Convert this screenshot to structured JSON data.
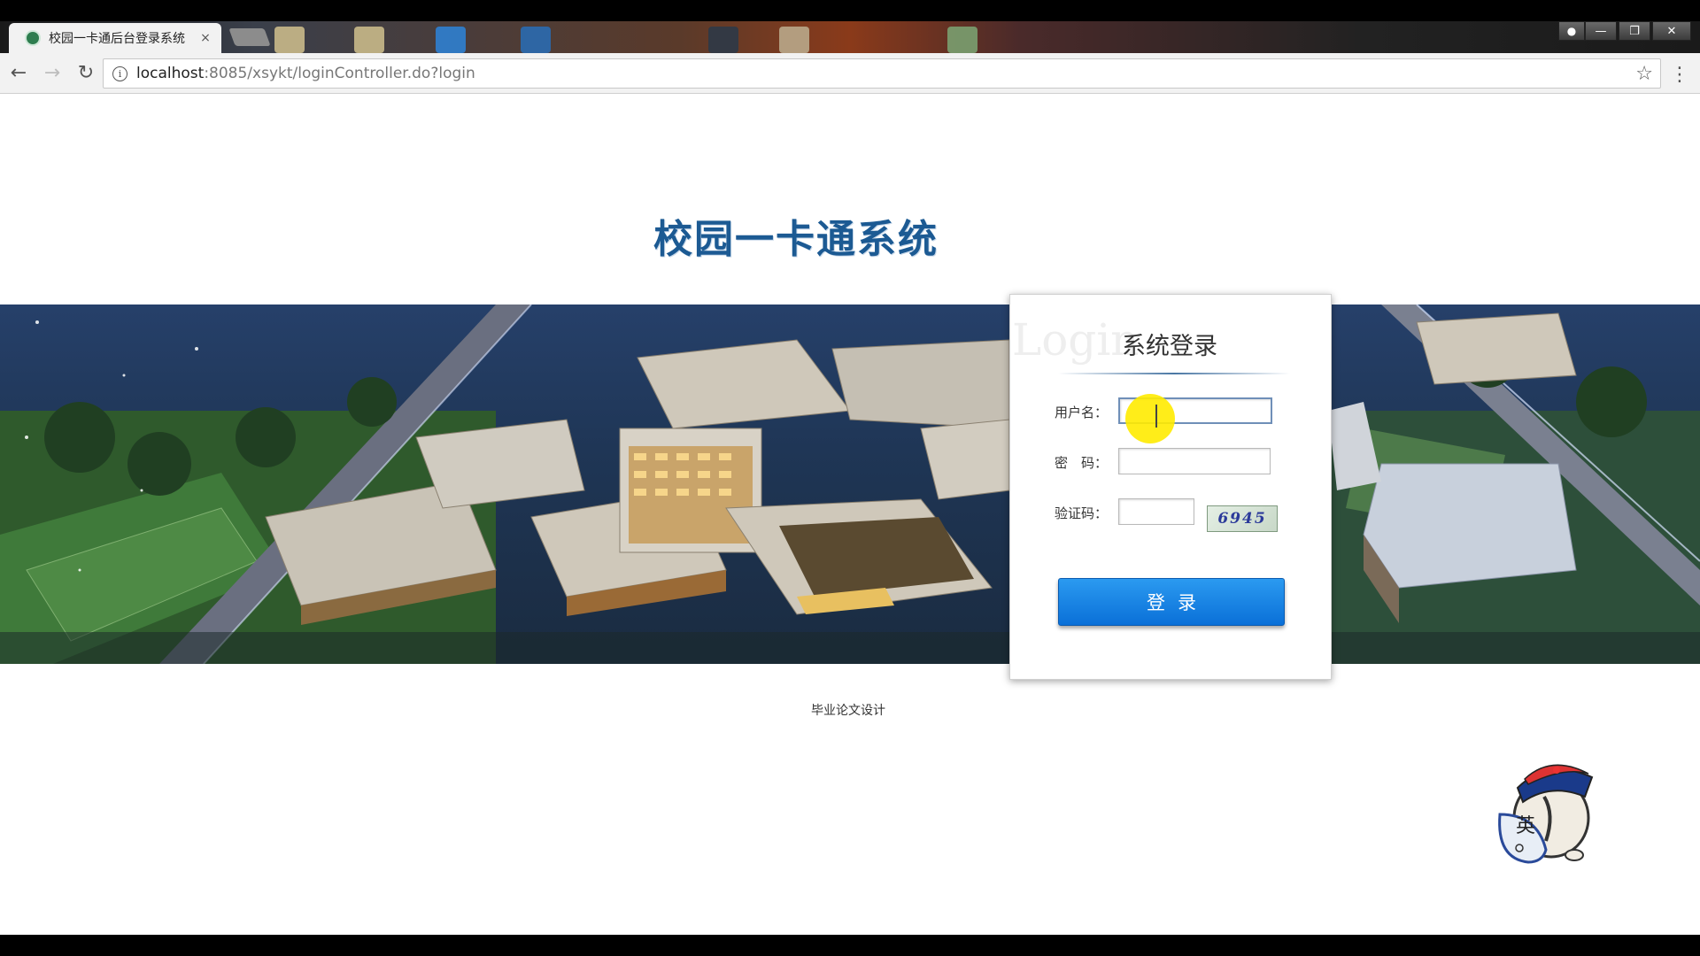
{
  "browser": {
    "tab_title": "校园一卡通后台登录系统",
    "tab_close": "×",
    "url_host": "localhost",
    "url_rest": ":8085/xsykt/loginController.do?login"
  },
  "page": {
    "site_title": "校园一卡通系统",
    "footer": "毕业论文设计"
  },
  "login": {
    "watermark": "Login",
    "heading": "系统登录",
    "username_label": "用户名：",
    "username_value": "",
    "password_label": "密　码：",
    "password_value": "",
    "captcha_label": "验证码：",
    "captcha_value": "",
    "captcha_image_text": "6945",
    "submit_label": "登录"
  },
  "mascot": {
    "badge_char": "英"
  },
  "colors": {
    "title": "#1c5a93",
    "button": "#1a86e6",
    "cursor_highlight": "#ffeb00"
  }
}
